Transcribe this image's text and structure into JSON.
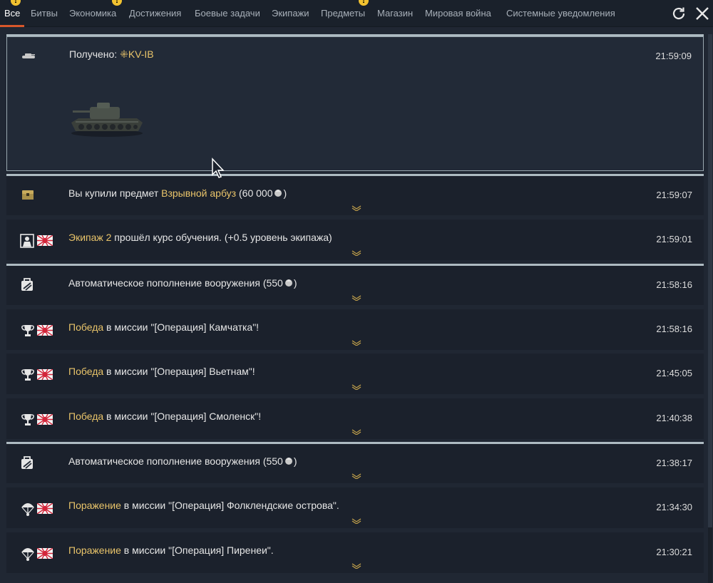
{
  "tabs": [
    {
      "label": "Все",
      "active": true,
      "alert": true
    },
    {
      "label": "Битвы",
      "active": false,
      "alert": false
    },
    {
      "label": "Экономика",
      "active": false,
      "alert": true
    },
    {
      "label": "Достижения",
      "active": false,
      "alert": false
    },
    {
      "label": "Боевые задачи",
      "active": false,
      "alert": false
    },
    {
      "label": "Экипажи",
      "active": false,
      "alert": false
    },
    {
      "label": "Предметы",
      "active": false,
      "alert": true
    },
    {
      "label": "Магазин",
      "active": false,
      "alert": false
    },
    {
      "label": "Мировая война",
      "active": false,
      "alert": false
    },
    {
      "label": "Системные уведомления",
      "active": false,
      "alert": false
    }
  ],
  "alert_symbol": "!",
  "toolbar": {
    "refresh_icon": "refresh-icon",
    "close_icon": "close-icon"
  },
  "colors": {
    "highlight": "#e9c46a",
    "active_tab_underline": "#d8572a",
    "separator": "#aebbc2",
    "alert": "#f2c230"
  },
  "notifications": [
    {
      "icon": "tank-icon",
      "flag": "",
      "parts": [
        "Получено: ",
        "⁜KV-IB"
      ],
      "time": "21:59:09",
      "expanded": true
    },
    {
      "icon": "chest-icon",
      "flag": "",
      "parts": [
        "Вы купили предмет ",
        "Взрывной арбуз",
        " (60 000",
        ")"
      ],
      "time": "21:59:07",
      "coin": true
    },
    {
      "icon": "crew-icon",
      "flag": "japan-flag-icon",
      "parts": [
        "Экипаж 2",
        " прошёл курс обучения. (+0.5 уровень экипажа)"
      ],
      "time": "21:59:01"
    },
    {
      "icon": "ammo-bag-icon",
      "flag": "",
      "parts": [
        "Автоматическое пополнение вооружения (550",
        ")"
      ],
      "time": "21:58:16",
      "coin": true
    },
    {
      "icon": "trophy-icon",
      "flag": "japan-flag-icon",
      "parts": [
        "Победа",
        " в миссии \"[Операция] Камчатка\"!"
      ],
      "time": "21:58:16"
    },
    {
      "icon": "trophy-icon",
      "flag": "japan-flag-icon",
      "parts": [
        "Победа",
        " в миссии \"[Операция] Вьетнам\"!"
      ],
      "time": "21:45:05"
    },
    {
      "icon": "trophy-icon",
      "flag": "japan-flag-icon",
      "parts": [
        "Победа",
        " в миссии \"[Операция] Смоленск\"!"
      ],
      "time": "21:40:38"
    },
    {
      "icon": "ammo-bag-icon",
      "flag": "",
      "parts": [
        "Автоматическое пополнение вооружения (550",
        ")"
      ],
      "time": "21:38:17",
      "coin": true
    },
    {
      "icon": "parachute-icon",
      "flag": "japan-flag-icon",
      "parts": [
        "Поражение",
        " в миссии \"[Операция] Фолклендские острова\"."
      ],
      "time": "21:34:30"
    },
    {
      "icon": "parachute-icon",
      "flag": "japan-flag-icon",
      "parts": [
        "Поражение",
        " в миссии \"[Операция] Пиренеи\"."
      ],
      "time": "21:30:21"
    }
  ]
}
